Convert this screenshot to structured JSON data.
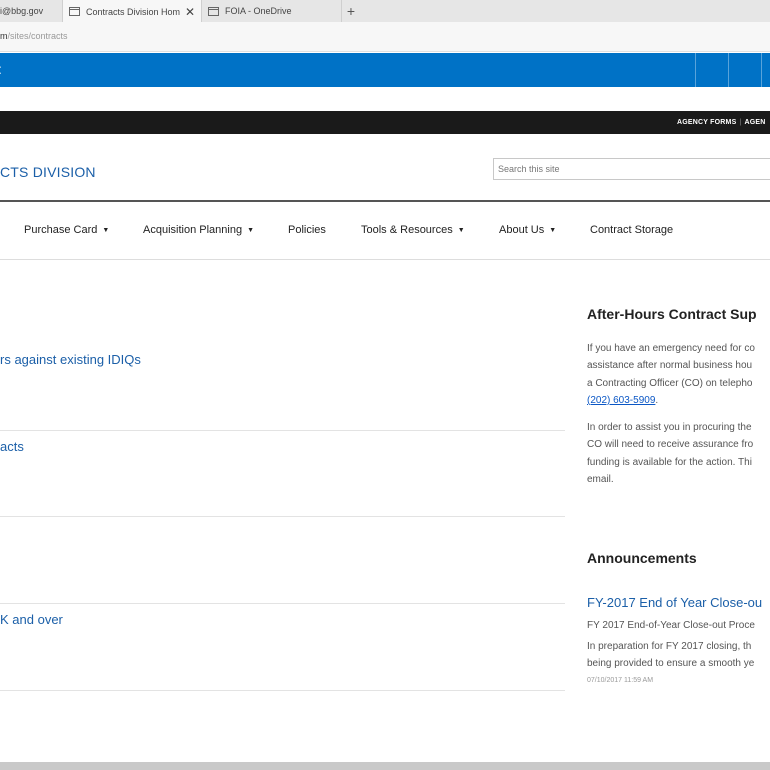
{
  "browser": {
    "tabs": [
      {
        "label": "i@bbg.gov"
      },
      {
        "label": "Contracts Division Hom",
        "close": "✕"
      },
      {
        "label": "FOIA - OneDrive"
      }
    ],
    "new_tab": "+",
    "url_domain_tail": "m",
    "url_path": "/sites/contracts"
  },
  "suitebar": {
    "color": "#0072c6",
    "glyph": ":"
  },
  "utility": {
    "link1": "AGENCY FORMS",
    "separator": "|",
    "link2": "AGEN"
  },
  "site": {
    "title": "CTS DIVISION",
    "search_placeholder": "Search this site"
  },
  "nav": {
    "items": [
      {
        "label": "Purchase Card",
        "caret": "▼"
      },
      {
        "label": "Acquisition Planning",
        "caret": "▼"
      },
      {
        "label": "Policies"
      },
      {
        "label": "Tools & Resources",
        "caret": "▼"
      },
      {
        "label": "About Us",
        "caret": "▼"
      },
      {
        "label": "Contract Storage"
      }
    ]
  },
  "main": {
    "rows": [
      {
        "title": "rs against existing IDIQs"
      },
      {
        "title": "acts"
      },
      {
        "title": ""
      },
      {
        "title": "K and over"
      }
    ]
  },
  "sidebar": {
    "after_hours": {
      "heading": "After-Hours Contract Sup",
      "p1_lines": [
        "If you have an emergency need for co",
        "assistance after normal business hou",
        "a Contracting Officer (CO) on telepho"
      ],
      "phone": "(202) 603-5909",
      "phone_suffix": ".",
      "p2_lines": [
        "In order to assist you in procuring the",
        "CO will need to receive assurance fro",
        "funding is available for the action. Thi",
        "email."
      ]
    },
    "announcements": {
      "heading": "Announcements",
      "title": "FY-2017 End of Year Close-ou",
      "lines": [
        "FY 2017 End-of-Year Close-out Proce",
        "In preparation for FY 2017 closing, th",
        "being provided to ensure a smooth ye"
      ],
      "date": "07/10/2017 11:59 AM"
    }
  }
}
